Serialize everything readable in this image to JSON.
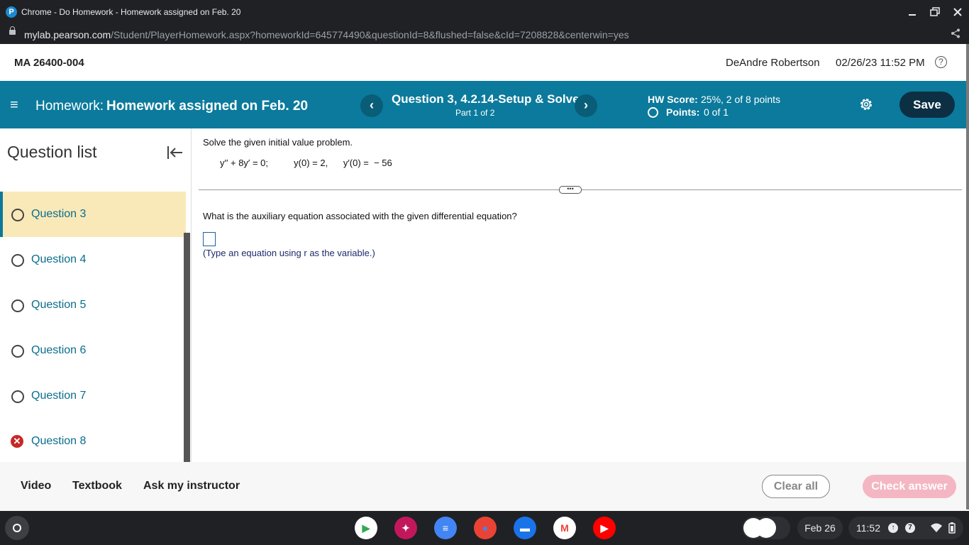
{
  "window": {
    "title": "Chrome - Do Homework - Homework assigned on Feb. 20",
    "logo_letter": "P",
    "minimize_icon": "minimize-icon",
    "maximize_icon": "restore-icon",
    "close_icon": "close-icon"
  },
  "urlbar": {
    "host": "mylab.pearson.com",
    "path": "/Student/PlayerHomework.aspx?homeworkId=645774490&questionId=8&flushed=false&cId=7208828&centerwin=yes",
    "share_icon": "share-icon"
  },
  "header": {
    "course": "MA 26400-004",
    "user": "DeAndre Robertson",
    "datetime": "02/26/23 11:52 PM",
    "help_glyph": "?"
  },
  "navbar": {
    "menu_glyph": "≡",
    "hw_prefix": "Homework:",
    "hw_title": "Homework assigned on Feb. 20",
    "prev_glyph": "‹",
    "next_glyph": "›",
    "question_title": "Question 3, 4.2.14-Setup & Solve",
    "question_part": "Part 1 of 2",
    "score_label": "HW Score:",
    "score_value": "25%, 2 of 8 points",
    "points_label": "Points:",
    "points_value": "0 of 1",
    "save_label": "Save",
    "accent": "#0b7a9c"
  },
  "sidebar": {
    "title": "Question list",
    "items": [
      {
        "label": "Question 3",
        "status": "active"
      },
      {
        "label": "Question 4",
        "status": "unanswered"
      },
      {
        "label": "Question 5",
        "status": "unanswered"
      },
      {
        "label": "Question 6",
        "status": "unanswered"
      },
      {
        "label": "Question 7",
        "status": "unanswered"
      },
      {
        "label": "Question 8",
        "status": "incorrect"
      }
    ]
  },
  "problem": {
    "instruction": "Solve the given initial value problem.",
    "equation": "y′′ + 8y′ = 0;          y(0) = 2,      y′(0) =  − 56",
    "divider_glyph": "•••",
    "question": "What is the auxiliary equation associated with the given differential equation?",
    "answer_value": "",
    "answer_hint": "(Type an equation using r as the variable.)"
  },
  "footer": {
    "video": "Video",
    "textbook": "Textbook",
    "ask": "Ask my instructor",
    "clear_all": "Clear all",
    "check_answer": "Check answer"
  },
  "shelf": {
    "apps": [
      {
        "name": "play-store-icon",
        "glyph": "▶",
        "color": "#ffffff",
        "fg": "#34a853"
      },
      {
        "name": "app-icon",
        "glyph": "✦",
        "color": "#c2185b",
        "fg": "#ffffff"
      },
      {
        "name": "docs-icon",
        "glyph": "≡",
        "color": "#4285f4",
        "fg": "#ffffff"
      },
      {
        "name": "chrome-icon",
        "glyph": "●",
        "color": "#ea4335",
        "fg": "#4285f4"
      },
      {
        "name": "files-icon",
        "glyph": "▬",
        "color": "#1a73e8",
        "fg": "#ffffff"
      },
      {
        "name": "gmail-icon",
        "glyph": "M",
        "color": "#ffffff",
        "fg": "#ea4335"
      },
      {
        "name": "youtube-icon",
        "glyph": "▶",
        "color": "#ff0000",
        "fg": "#ffffff"
      }
    ],
    "date": "Feb 26",
    "time": "11:52",
    "notification_count": "7"
  }
}
